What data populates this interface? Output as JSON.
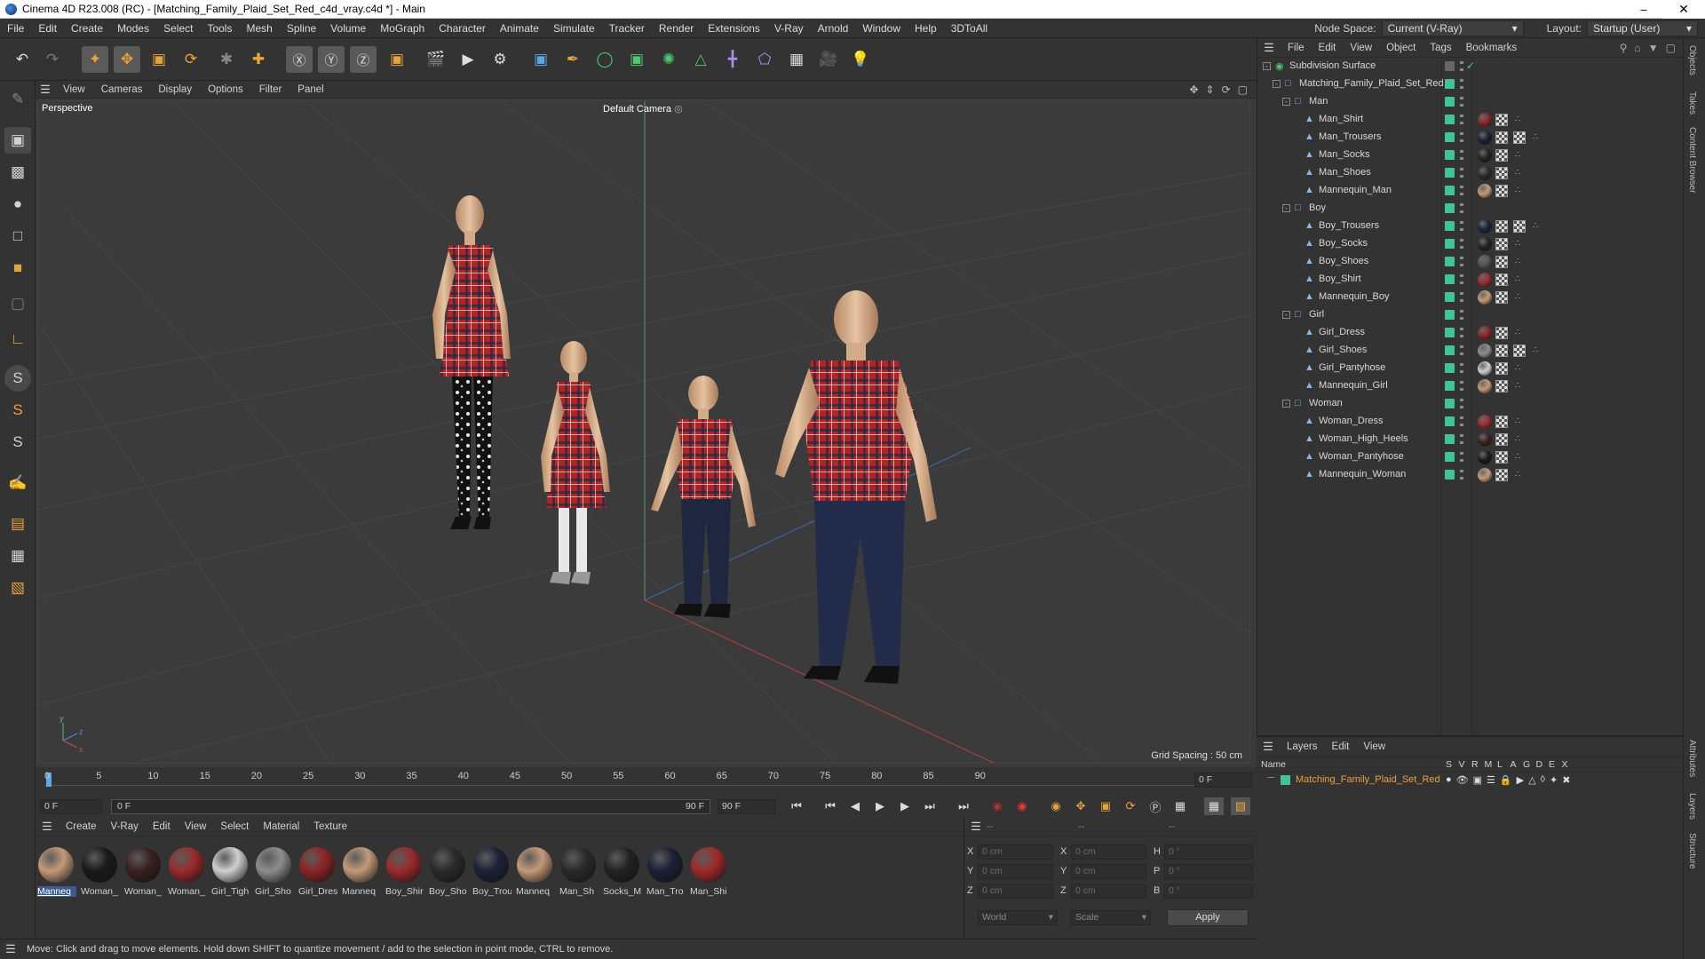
{
  "window": {
    "title": "Cinema 4D R23.008 (RC) - [Matching_Family_Plaid_Set_Red_c4d_vray.c4d *] - Main"
  },
  "menu": [
    "File",
    "Edit",
    "Create",
    "Modes",
    "Select",
    "Tools",
    "Mesh",
    "Spline",
    "Volume",
    "MoGraph",
    "Character",
    "Animate",
    "Simulate",
    "Tracker",
    "Render",
    "Extensions",
    "V-Ray",
    "Arnold",
    "Window",
    "Help",
    "3DToAll"
  ],
  "nodespace": {
    "label": "Node Space:",
    "value": "Current (V-Ray)",
    "layout_label": "Layout:",
    "layout_value": "Startup (User)"
  },
  "viewport": {
    "menu": [
      "View",
      "Cameras",
      "Display",
      "Options",
      "Filter",
      "Panel"
    ],
    "name": "Perspective",
    "camera": "Default Camera",
    "grid_spacing": "Grid Spacing : 50 cm"
  },
  "timeline": {
    "ticks": [
      "0",
      "5",
      "10",
      "15",
      "20",
      "25",
      "30",
      "35",
      "40",
      "45",
      "50",
      "55",
      "60",
      "65",
      "70",
      "75",
      "80",
      "85",
      "90"
    ],
    "end_field": "0 F",
    "start": "0 F",
    "range_start": "0 F",
    "range_end": "90 F",
    "max": "90 F"
  },
  "material_manager": {
    "menu": [
      "Create",
      "V-Ray",
      "Edit",
      "View",
      "Select",
      "Material",
      "Texture"
    ],
    "materials": [
      {
        "label": "Manneq",
        "color": "#c49a78"
      },
      {
        "label": "Woman_",
        "color": "#1a1a1a"
      },
      {
        "label": "Woman_",
        "color": "#3a2020"
      },
      {
        "label": "Woman_",
        "color": "#9b2a2a"
      },
      {
        "label": "Girl_Tigh",
        "color": "#cfcfcf"
      },
      {
        "label": "Girl_Sho",
        "color": "#8d8d8d"
      },
      {
        "label": "Girl_Dres",
        "color": "#8e2424"
      },
      {
        "label": "Manneq",
        "color": "#c49a78"
      },
      {
        "label": "Boy_Shir",
        "color": "#9b2a2a"
      },
      {
        "label": "Boy_Sho",
        "color": "#2a2a2a"
      },
      {
        "label": "Boy_Trou",
        "color": "#1c2238"
      },
      {
        "label": "Manneq",
        "color": "#c49a78"
      },
      {
        "label": "Man_Sh",
        "color": "#2a2a2a"
      },
      {
        "label": "Socks_M",
        "color": "#222222"
      },
      {
        "label": "Man_Tro",
        "color": "#1a2035"
      },
      {
        "label": "Man_Shi",
        "color": "#a02a2a"
      }
    ]
  },
  "coordinates": {
    "headers": [
      "--",
      "--",
      "--"
    ],
    "rows": [
      {
        "a": "X",
        "av": "0 cm",
        "b": "X",
        "bv": "0 cm",
        "c": "H",
        "cv": "0 °"
      },
      {
        "a": "Y",
        "av": "0 cm",
        "b": "Y",
        "bv": "0 cm",
        "c": "P",
        "cv": "0 °"
      },
      {
        "a": "Z",
        "av": "0 cm",
        "b": "Z",
        "bv": "0 cm",
        "c": "B",
        "cv": "0 °"
      }
    ],
    "mode1": "World",
    "mode2": "Scale",
    "apply": "Apply"
  },
  "object_manager": {
    "menu": [
      "File",
      "Edit",
      "View",
      "Object",
      "Tags",
      "Bookmarks"
    ],
    "objects": [
      {
        "name": "Subdivision Surface",
        "level": 0,
        "type": "subd"
      },
      {
        "name": "Matching_Family_Plaid_Set_Red",
        "level": 1,
        "type": "null"
      },
      {
        "name": "Man",
        "level": 2,
        "type": "null"
      },
      {
        "name": "Man_Shirt",
        "level": 3,
        "type": "obj",
        "mat": "#8e2424"
      },
      {
        "name": "Man_Trousers",
        "level": 3,
        "type": "obj",
        "mat": "#1a2035",
        "extra": true
      },
      {
        "name": "Man_Socks",
        "level": 3,
        "type": "obj",
        "mat": "#222222"
      },
      {
        "name": "Man_Shoes",
        "level": 3,
        "type": "obj",
        "mat": "#2a2a2a"
      },
      {
        "name": "Mannequin_Man",
        "level": 3,
        "type": "obj",
        "mat": "#c49a78"
      },
      {
        "name": "Boy",
        "level": 2,
        "type": "null"
      },
      {
        "name": "Boy_Trousers",
        "level": 3,
        "type": "obj",
        "mat": "#1c2238",
        "extra": true
      },
      {
        "name": "Boy_Socks",
        "level": 3,
        "type": "obj",
        "mat": "#222222"
      },
      {
        "name": "Boy_Shoes",
        "level": 3,
        "type": "obj",
        "mat": "#555555"
      },
      {
        "name": "Boy_Shirt",
        "level": 3,
        "type": "obj",
        "mat": "#9b2a2a"
      },
      {
        "name": "Mannequin_Boy",
        "level": 3,
        "type": "obj",
        "mat": "#c49a78"
      },
      {
        "name": "Girl",
        "level": 2,
        "type": "null"
      },
      {
        "name": "Girl_Dress",
        "level": 3,
        "type": "obj",
        "mat": "#8e2424"
      },
      {
        "name": "Girl_Shoes",
        "level": 3,
        "type": "obj",
        "mat": "#8d8d8d",
        "extra": true
      },
      {
        "name": "Girl_Pantyhose",
        "level": 3,
        "type": "obj",
        "mat": "#cfcfcf"
      },
      {
        "name": "Mannequin_Girl",
        "level": 3,
        "type": "obj",
        "mat": "#c49a78"
      },
      {
        "name": "Woman",
        "level": 2,
        "type": "null"
      },
      {
        "name": "Woman_Dress",
        "level": 3,
        "type": "obj",
        "mat": "#9b2a2a"
      },
      {
        "name": "Woman_High_Heels",
        "level": 3,
        "type": "obj",
        "mat": "#3a2020"
      },
      {
        "name": "Woman_Pantyhose",
        "level": 3,
        "type": "obj",
        "mat": "#1a1a1a"
      },
      {
        "name": "Mannequin_Woman",
        "level": 3,
        "type": "obj",
        "mat": "#c49a78"
      }
    ]
  },
  "layer_manager": {
    "menu": [
      "Layers",
      "Edit",
      "View"
    ],
    "columns": [
      "Name",
      "S",
      "V",
      "R",
      "M",
      "L",
      "A",
      "G",
      "D",
      "E",
      "X"
    ],
    "layer": "Matching_Family_Plaid_Set_Red"
  },
  "right_tabs": [
    "Objects",
    "Takes",
    "Content Browser",
    "Attributes",
    "Layers",
    "Structure"
  ],
  "status": "Move: Click and drag to move elements. Hold down SHIFT to quantize movement / add to the selection in point mode, CTRL to remove.",
  "colors": {
    "accent": "#40c39c",
    "layer_name": "#e8a23c",
    "panel": "#333333",
    "viewport": "#3b3b3b"
  }
}
